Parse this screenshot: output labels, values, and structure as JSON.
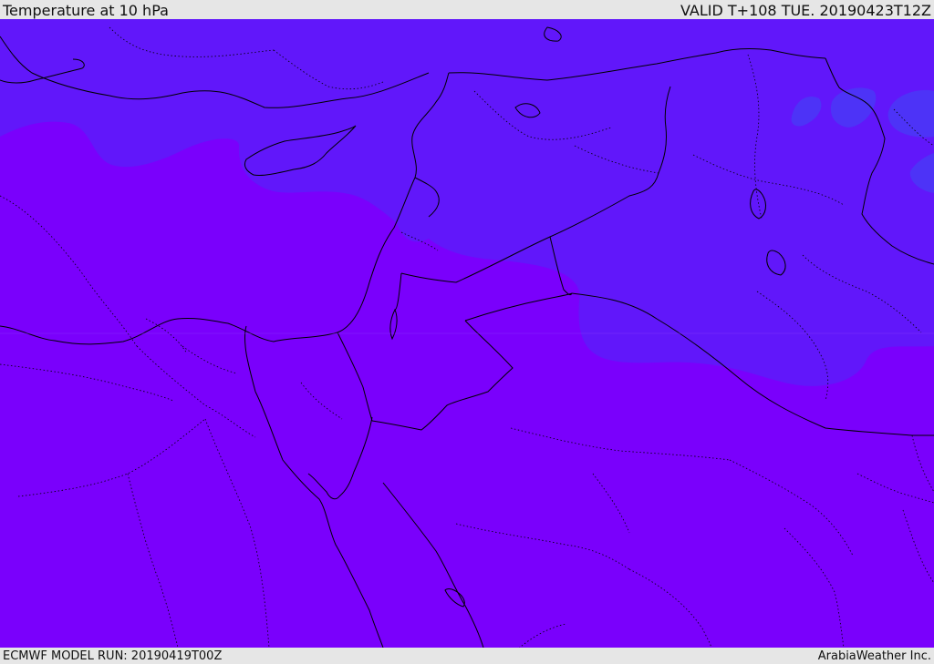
{
  "header": {
    "title": "Temperature at 10 hPa",
    "valid_time": "VALID T+108 TUE. 20190423T12Z"
  },
  "footer": {
    "model_run": "ECMWF MODEL RUN: 20190419T00Z",
    "credit": "ArabiaWeather Inc."
  },
  "map": {
    "colors": {
      "warm_fill": "#7a00fc",
      "cool_fill": "#6117fa",
      "coolest_fill": "#4d33f7",
      "border_line": "#000000"
    }
  }
}
